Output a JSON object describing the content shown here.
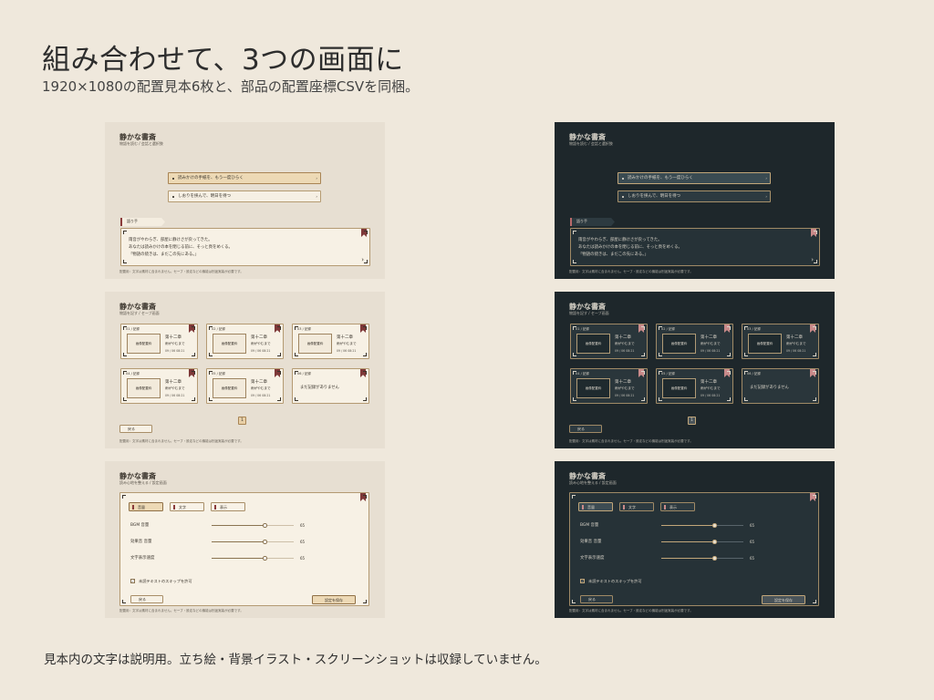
{
  "header": {
    "title": "組み合わせて、3つの画面に",
    "subtitle": "1920×1080の配置見本6枚と、部品の配置座標CSVを同梱。"
  },
  "footer": {
    "note": "見本内の文字は説明用。立ち絵・背景イラスト・スクリーンショットは収録していません。"
  },
  "common": {
    "app_title": "静かな書斎",
    "footer_note": "配置用：文字は素材に含まれません。セーブ・設定などの機能は別途実装が必要です。"
  },
  "colors": {
    "background": "#EFE8DC",
    "light_panel": "#E7DFD2",
    "dark_panel": "#1E272B",
    "accent_ribbon": "#7E3838",
    "gold_frame": "#B49A72"
  },
  "dialogue": {
    "subtitle": "物語を読む / 会話と選択肢",
    "choices": [
      {
        "label": "読みかけの手紙を、もう一度ひらく"
      },
      {
        "label": "しおりを挟んで、明日を待つ"
      }
    ],
    "speaker": "語り手",
    "lines": [
      "雨音がやわらぎ、部屋に静けさが戻ってきた。",
      "あなたは読みかけの本を閉じる前に、そっと頁をめくる。",
      "「物語の続きは、まだこの先にある。」"
    ],
    "next_icon": "›"
  },
  "save": {
    "subtitle": "物語を記す / セーブ画面",
    "slots": [
      {
        "num": "01 / 記録",
        "thumb": "画像配置枠",
        "chapter": "第十二章",
        "scene": "雨がやむまで",
        "time": "09 / 06 08:21"
      },
      {
        "num": "02 / 記録",
        "thumb": "画像配置枠",
        "chapter": "第十二章",
        "scene": "雨がやむまで",
        "time": "09 / 06 08:21"
      },
      {
        "num": "03 / 記録",
        "thumb": "画像配置枠",
        "chapter": "第十二章",
        "scene": "雨がやむまで",
        "time": "09 / 06 08:21"
      },
      {
        "num": "04 / 記録",
        "thumb": "画像配置枠",
        "chapter": "第十二章",
        "scene": "雨がやむまで",
        "time": "09 / 06 08:21"
      },
      {
        "num": "05 / 記録",
        "thumb": "画像配置枠",
        "chapter": "第十二章",
        "scene": "雨がやむまで",
        "time": "09 / 06 08:21"
      },
      {
        "num": "06 / 記録",
        "empty": "まだ記録がありません"
      }
    ],
    "back_label": "戻る",
    "page": "1"
  },
  "settings": {
    "subtitle": "読み心地を整える / 設定画面",
    "tabs": [
      {
        "label": "音量",
        "active": true
      },
      {
        "label": "文字",
        "active": false
      },
      {
        "label": "表示",
        "active": false
      }
    ],
    "sliders": [
      {
        "label": "BGM 音量",
        "value": 65,
        "display": "65"
      },
      {
        "label": "効果音 音量",
        "value": 65,
        "display": "65"
      },
      {
        "label": "文字表示速度",
        "value": 65,
        "display": "65"
      }
    ],
    "checkbox_label": "未読テキストのスキップを許可",
    "checkbox_mark": "✓",
    "back_label": "戻る",
    "save_label": "設定を保存"
  }
}
